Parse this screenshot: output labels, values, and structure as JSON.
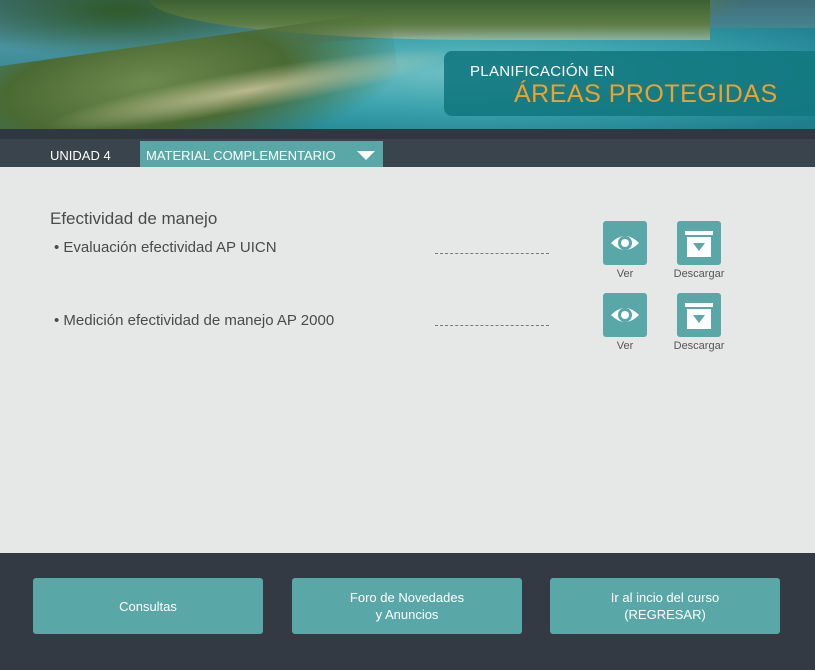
{
  "banner": {
    "title_line1": "PLANIFICACIÓN EN",
    "title_line2": "ÁREAS PROTEGIDAS",
    "accent_color": "#f0a12a"
  },
  "unit": {
    "label": "UNIDAD 4",
    "dropdown_label": "MATERIAL COMPLEMENTARIO"
  },
  "content": {
    "section_title": "Efectividad de manejo",
    "items": [
      {
        "label": "•  Evaluación efectividad AP UICN",
        "view_label": "Ver",
        "download_label": "Descargar"
      },
      {
        "label": "• Medición efectividad de manejo AP 2000",
        "view_label": "Ver",
        "download_label": "Descargar"
      }
    ]
  },
  "footer": {
    "consultas": "Consultas",
    "foro_line1": "Foro de Novedades",
    "foro_line2": "y Anuncios",
    "inicio_line1": "Ir al incio del curso",
    "inicio_line2": "(REGRESAR)"
  },
  "colors": {
    "teal": "#5aa7a8",
    "dark": "#343a43"
  }
}
